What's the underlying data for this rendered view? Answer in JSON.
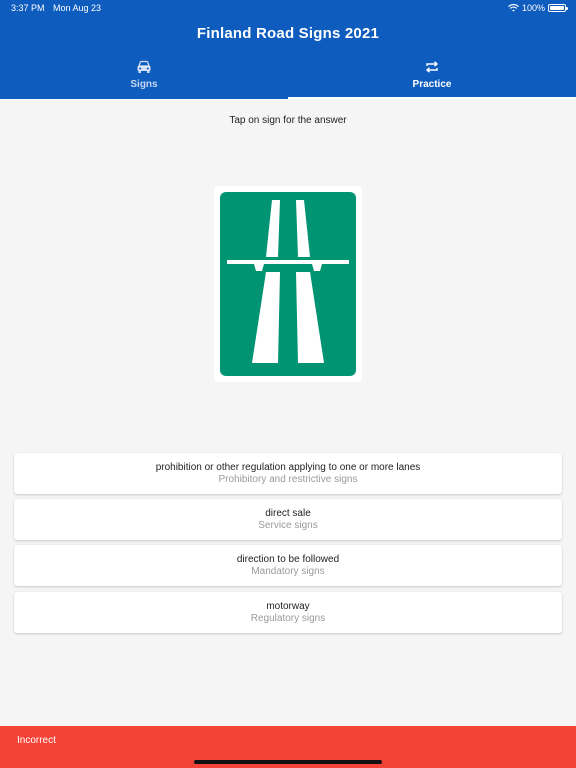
{
  "status_bar": {
    "time": "3:37 PM",
    "date": "Mon Aug 23",
    "battery": "100%"
  },
  "app": {
    "title": "Finland Road Signs 2021"
  },
  "tabs": [
    {
      "label": "Signs",
      "icon": "car-icon",
      "selected": false
    },
    {
      "label": "Practice",
      "icon": "repeat-icon",
      "selected": true
    }
  ],
  "practice": {
    "instruction": "Tap on sign for the answer",
    "sign": {
      "name": "motorway",
      "colors": {
        "background": "#009473",
        "border": "#ffffff"
      }
    }
  },
  "answers": [
    {
      "title": "prohibition or other regulation applying to one or more lanes",
      "category": "Prohibitory and restrictive signs"
    },
    {
      "title": "direct sale",
      "category": "Service signs"
    },
    {
      "title": "direction to be followed",
      "category": "Mandatory signs"
    },
    {
      "title": "motorway",
      "category": "Regulatory signs"
    }
  ],
  "feedback": {
    "message": "Incorrect",
    "color": "#f44336"
  },
  "colors": {
    "header": "#0f5cbf",
    "background": "#f5f5f5"
  }
}
